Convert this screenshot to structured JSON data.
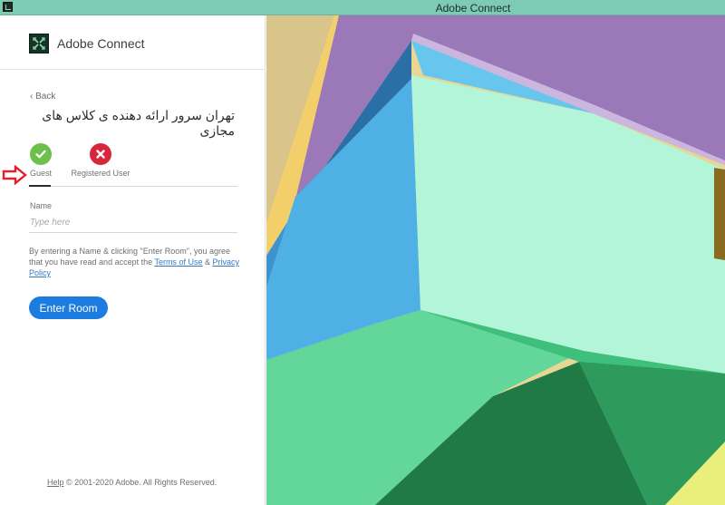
{
  "window": {
    "title": "Adobe Connect"
  },
  "brand": {
    "name": "Adobe Connect"
  },
  "back_label": "Back",
  "room_title": "تهران سرور ارائه دهنده ی کلاس های مجازی",
  "roles": [
    {
      "label": "Guest",
      "status": "check-icon",
      "color": "#6dc04c",
      "selected": true
    },
    {
      "label": "Registered User",
      "status": "close-icon",
      "color": "#d7273c",
      "selected": false
    }
  ],
  "name_field": {
    "label": "Name",
    "placeholder": "Type here",
    "value": ""
  },
  "agreement": {
    "text_before": "By entering a Name & clicking \"Enter Room\", you agree that you have read and accept the ",
    "terms_link": "Terms of Use",
    "text_and": " & ",
    "privacy_link": "Privacy Policy"
  },
  "enter_button": "Enter Room",
  "footer": {
    "help": "Help",
    "copyright": "© 2001-2020 Adobe. All Rights Reserved."
  },
  "colors": {
    "accent": "#1c7ce0",
    "titlebar": "#7ecbb3",
    "annotation_arrow": "#e0202e"
  }
}
